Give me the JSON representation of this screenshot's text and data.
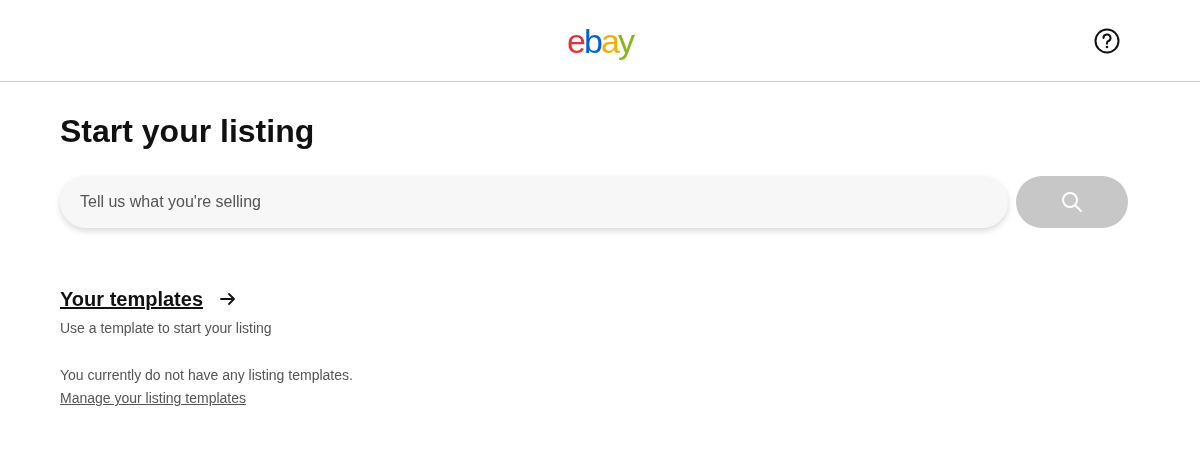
{
  "header": {
    "logo": "ebay"
  },
  "title": "Start your listing",
  "search": {
    "placeholder": "Tell us what you're selling"
  },
  "templates": {
    "heading": "Your templates",
    "subtitle": "Use a template to start your listing",
    "empty_message": "You currently do not have any listing templates.",
    "manage_link": "Manage your listing templates"
  }
}
